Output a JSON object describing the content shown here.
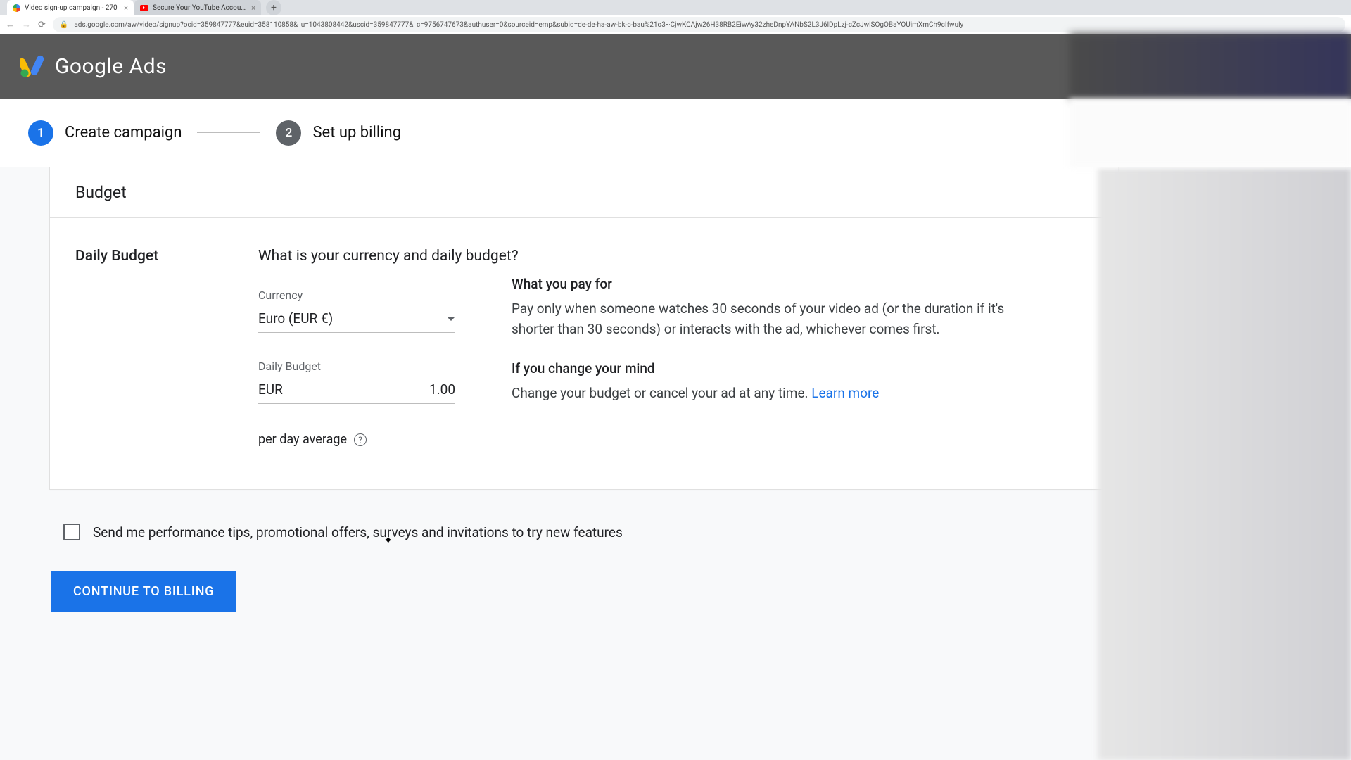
{
  "browser": {
    "tabs": [
      {
        "title": "Video sign-up campaign - 270"
      },
      {
        "title": "Secure Your YouTube Account"
      }
    ],
    "url": "ads.google.com/aw/video/signup?ocid=359847777&euid=358110858&_u=1043808442&uscid=359847777&_c=9756747673&authuser=0&sourceid=emp&subid=de-de-ha-aw-bk-c-bau%21o3~CjwKCAjw26H38RB2EiwAy32zheDnpYANbS2L3J6lDpLzj-cZcJwlSOgOBaYOUimXmCh9cIfwuly"
  },
  "header": {
    "brand": "Google Ads"
  },
  "stepper": {
    "steps": [
      {
        "num": "1",
        "label": "Create campaign"
      },
      {
        "num": "2",
        "label": "Set up billing"
      }
    ]
  },
  "card": {
    "title": "Budget",
    "section": "Daily Budget",
    "question": "What is your currency and daily budget?",
    "currency_label": "Currency",
    "currency_value": "Euro (EUR €)",
    "budget_label": "Daily Budget",
    "budget_prefix": "EUR",
    "budget_value": "1.00",
    "hint": "per day average"
  },
  "info": {
    "pay_title": "What you pay for",
    "pay_text": "Pay only when someone watches 30 seconds of your video ad (or the duration if it's shorter than 30 seconds) or interacts with the ad, whichever comes first.",
    "change_title": "If you change your mind",
    "change_text": "Change your budget or cancel your ad at any time. ",
    "learn_more": "Learn more"
  },
  "checkbox": {
    "label": "Send me performance tips, promotional offers, surveys and invitations to try new features"
  },
  "cta": {
    "label": "CONTINUE TO BILLING"
  }
}
